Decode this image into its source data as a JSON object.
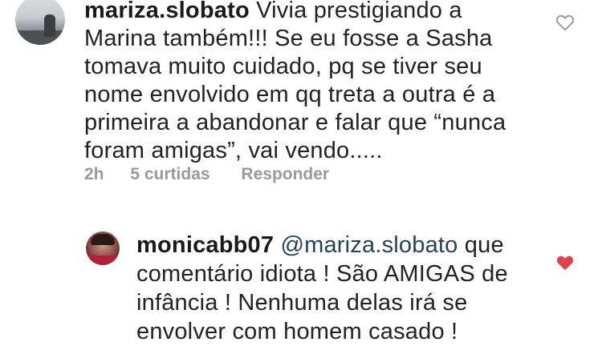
{
  "comments": [
    {
      "username": "mariza.slobato",
      "lines": [
        "Vivia prestigiando a",
        "Marina também!!! Se eu fosse a Sasha",
        "tomava muito cuidado, pq se tiver seu",
        "nome envolvido em qq treta a outra é a",
        "primeira a abandonar e falar que “nunca",
        "foram amigas”, vai vendo....."
      ],
      "time": "2h",
      "likes": "5 curtidas",
      "reply_label": "Responder",
      "heart_icon": "heart-outline-icon",
      "liked": false
    },
    {
      "username": "monicabb07",
      "mention": "@mariza.slobato",
      "lines": [
        "que",
        "comentário idiota ! São AMIGAS de",
        "infância !  Nenhuma delas irá se",
        "envolver com homem casado !"
      ],
      "heart_icon": "heart-filled-icon",
      "liked": true,
      "heart_color": "#e0424d"
    }
  ]
}
